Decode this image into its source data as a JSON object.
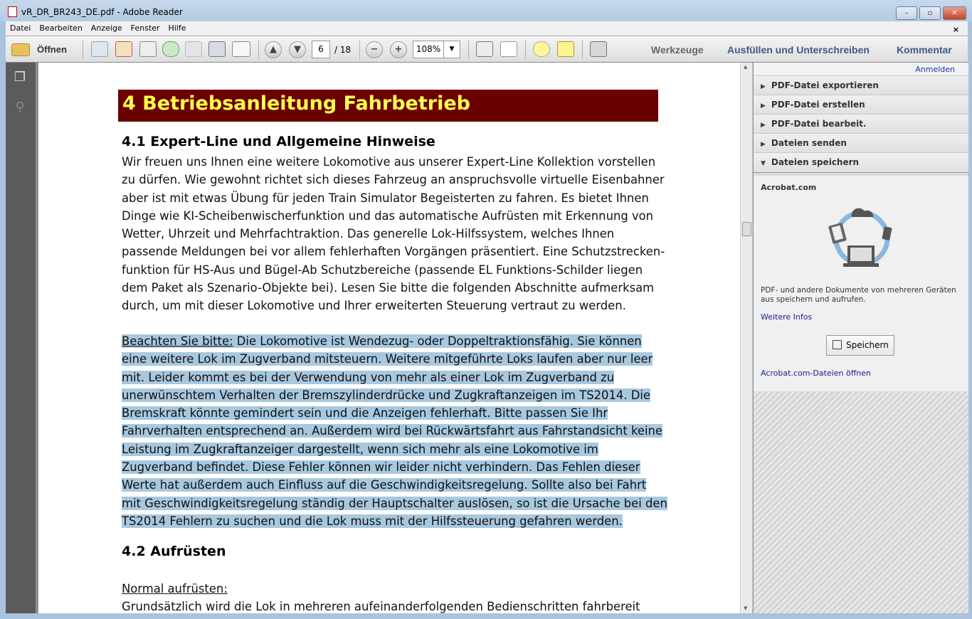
{
  "window": {
    "title": "vR_DR_BR243_DE.pdf - Adobe Reader",
    "minimize": "–",
    "maximize": "▫",
    "close": "✕"
  },
  "menu": [
    "Datei",
    "Bearbeiten",
    "Anzeige",
    "Fenster",
    "Hilfe"
  ],
  "menu_close": "×",
  "toolbar": {
    "open_label": "Öffnen",
    "page_current": "6",
    "page_total": "/ 18",
    "zoom": "108%",
    "tools": "Werkzeuge",
    "fill_sign": "Ausfüllen und Unterschreiben",
    "comment": "Kommentar"
  },
  "document": {
    "chapter": "4 Betriebsanleitung Fahrbetrieb",
    "section1": "4.1 Expert-Line und Allgemeine Hinweise",
    "para1": [
      "Wir freuen uns Ihnen eine weitere Lokomotive aus unserer Expert-Line Kollektion vorstellen",
      "zu dürfen. Wie gewohnt richtet sich dieses Fahrzeug an anspruchsvolle virtuelle Eisenbahner",
      "aber ist mit etwas Übung für jeden Train Simulator Begeisterten zu fahren. Es bietet Ihnen",
      "Dinge wie KI-Scheibenwischerfunktion und das automatische Aufrüsten mit Erkennung von",
      "Wetter, Uhrzeit und Mehrfachtraktion. Das generelle Lok-Hilfssystem, welches Ihnen",
      "passende Meldungen bei vor allem fehlerhaften Vorgängen präsentiert. Eine Schutzstrecken-",
      "funktion für HS-Aus und Bügel-Ab Schutzbereiche (passende EL Funktions-Schilder liegen",
      "dem Paket als Szenario-Objekte bei). Lesen Sie bitte die folgenden Abschnitte aufmerksam",
      "durch, um mit dieser Lokomotive und Ihrer erweiterten Steuerung vertraut zu werden."
    ],
    "note_label": "Beachten Sie bitte:",
    "note_first": " Die Lokomotive ist Wendezug- oder Doppeltraktionsfähig. Sie können",
    "para2": [
      "eine weitere Lok im Zugverband mitsteuern. Weitere mitgeführte Loks laufen aber nur leer",
      "mit. Leider kommt es bei der Verwendung von mehr als einer Lok im Zugverband zu",
      "unerwünschtem Verhalten der Bremszylinderdrücke und Zugkraftanzeigen im TS2014. Die",
      "Bremskraft könnte gemindert sein und die Anzeigen fehlerhaft. Bitte passen Sie Ihr",
      "Fahrverhalten entsprechend an. Außerdem wird bei Rückwärtsfahrt aus Fahrstandsicht keine",
      "Leistung im Zugkraftanzeiger dargestellt, wenn sich mehr als eine Lokomotive im",
      "Zugverband befindet. Diese Fehler können wir leider nicht verhindern. Das Fehlen dieser",
      "Werte hat außerdem auch Einfluss auf die Geschwindigkeitsregelung. Sollte also bei Fahrt",
      "mit Geschwindigkeitsregelung ständig der Hauptschalter auslösen, so ist die Ursache bei den",
      "TS2014 Fehlern zu suchen und die Lok muss mit der Hilfssteuerung gefahren werden."
    ],
    "section2": "4.2 Aufrüsten",
    "sub": "Normal aufrüsten:",
    "para3": "Grundsätzlich wird die Lok in mehreren aufeinanderfolgenden Bedienschritten fahrbereit"
  },
  "right_panel": {
    "signin": "Anmelden",
    "sections": [
      "PDF-Datei exportieren",
      "PDF-Datei erstellen",
      "PDF-Datei bearbeit.",
      "Dateien senden",
      "Dateien speichern"
    ],
    "acrobat_title": "Acrobat.com",
    "desc1": "PDF- und andere Dokumente von mehreren Geräten",
    "desc2": "aus speichern und aufrufen.",
    "more_info": "Weitere Infos",
    "save": "Speichern",
    "open_files": "Acrobat.com-Dateien öffnen"
  }
}
